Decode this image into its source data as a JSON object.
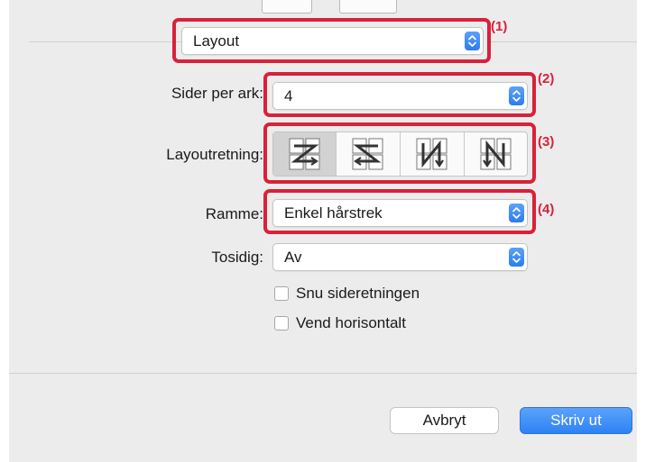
{
  "accent_color": "#2f82f5",
  "highlight_color": "#d9213a",
  "panel_selector": {
    "value": "Layout",
    "callout": "(1)"
  },
  "pages_per_sheet": {
    "label": "Sider per ark:",
    "value": "4",
    "callout": "(2)"
  },
  "layout_direction": {
    "label": "Layoutretning:",
    "callout": "(3)",
    "options": [
      {
        "icon": "z-order-right-then-down-icon",
        "selected": true
      },
      {
        "icon": "reverse-z-order-left-then-down-icon",
        "selected": false
      },
      {
        "icon": "n-order-down-then-right-icon",
        "selected": false
      },
      {
        "icon": "reverse-n-order-down-then-left-icon",
        "selected": false
      }
    ]
  },
  "border": {
    "label": "Ramme:",
    "value": "Enkel hårstrek",
    "callout": "(4)"
  },
  "two_sided": {
    "label": "Tosidig:",
    "value": "Av"
  },
  "checkboxes": {
    "flip_orientation": {
      "label": "Snu sideretningen",
      "checked": false
    },
    "flip_horizontal": {
      "label": "Vend horisontalt",
      "checked": false
    }
  },
  "buttons": {
    "cancel": "Avbryt",
    "print": "Skriv ut"
  }
}
